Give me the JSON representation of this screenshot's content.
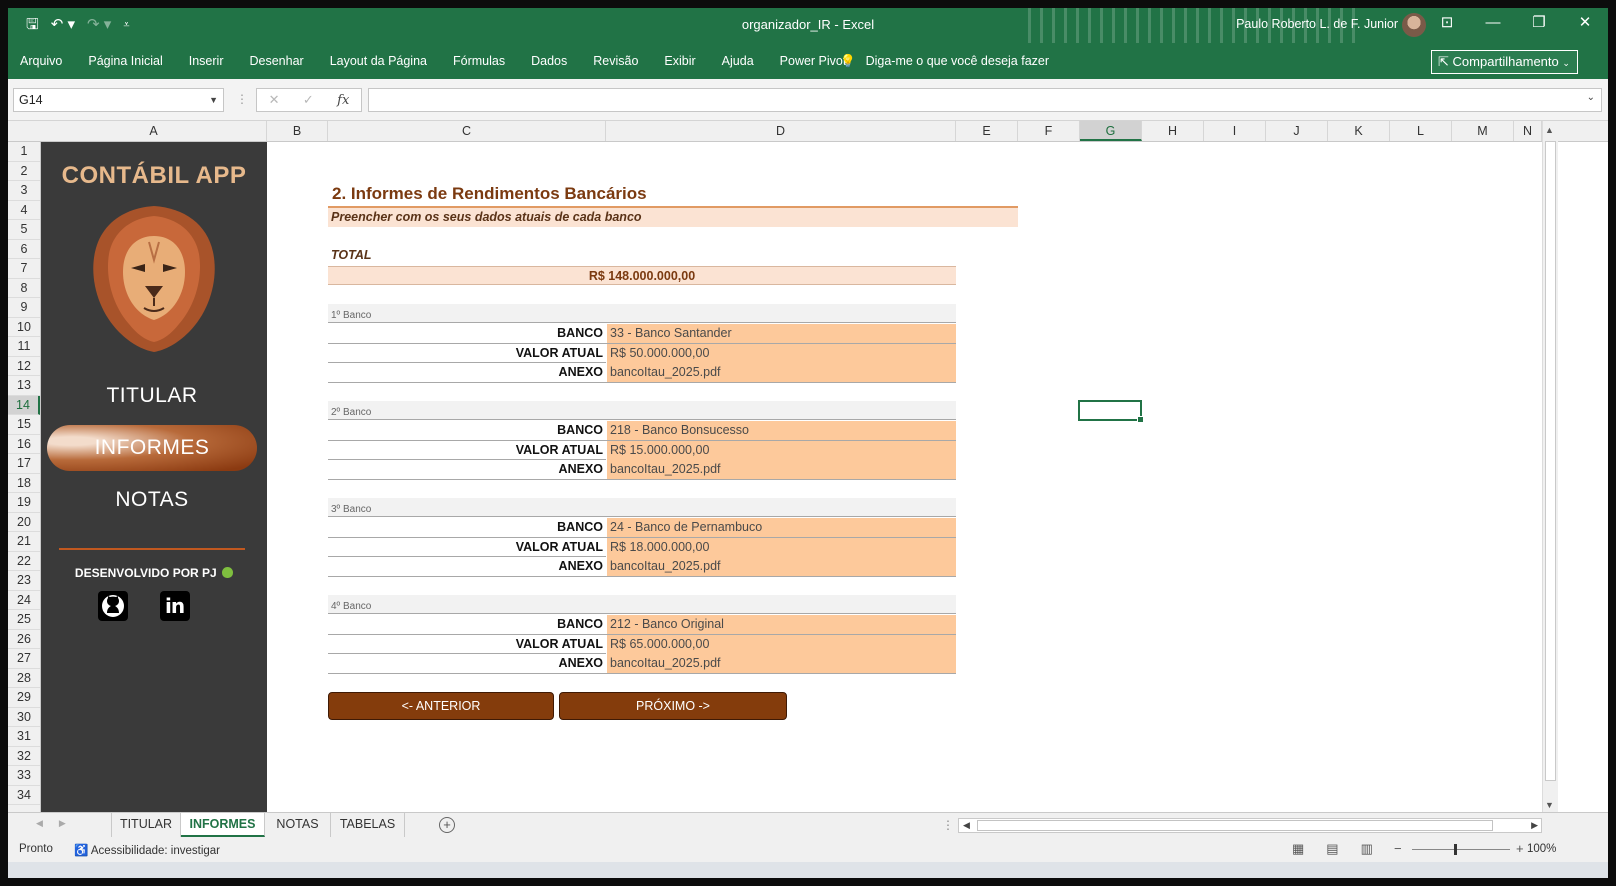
{
  "window": {
    "title": "organizador_IR  -  Excel",
    "user": "Paulo Roberto L. de F. Junior",
    "share_label": "Compartilhamento"
  },
  "ribbon": {
    "tabs": [
      "Arquivo",
      "Página Inicial",
      "Inserir",
      "Desenhar",
      "Layout da Página",
      "Fórmulas",
      "Dados",
      "Revisão",
      "Exibir",
      "Ajuda",
      "Power Pivot"
    ],
    "tell_me": "Diga-me o que você deseja fazer"
  },
  "formula_bar": {
    "name_box": "G14",
    "cancel_icon": "✕",
    "enter_icon": "✓",
    "fx_icon": "fx",
    "value": ""
  },
  "grid": {
    "columns": [
      "A",
      "B",
      "C",
      "D",
      "E",
      "F",
      "G",
      "H",
      "I",
      "J",
      "K",
      "L",
      "M",
      "N"
    ],
    "selected_column": "G",
    "rows": [
      "1",
      "2",
      "3",
      "4",
      "5",
      "6",
      "7",
      "8",
      "9",
      "10",
      "11",
      "12",
      "13",
      "14",
      "15",
      "16",
      "17",
      "18",
      "19",
      "20",
      "21",
      "22",
      "23",
      "24",
      "25",
      "26",
      "27",
      "28",
      "29",
      "30",
      "31",
      "32",
      "33",
      "34"
    ],
    "selected_row": "14"
  },
  "sidebar": {
    "brand": "CONTÁBIL APP",
    "nav": [
      {
        "label": "TITULAR",
        "active": false
      },
      {
        "label": "INFORMES",
        "active": true
      },
      {
        "label": "NOTAS",
        "active": false
      }
    ],
    "developed_by": "DESENVOLVIDO POR PJ",
    "social": [
      "github-icon",
      "linkedin-icon"
    ],
    "linkedin_text": "in"
  },
  "form": {
    "title": "2. Informes de Rendimentos Bancários",
    "subtitle": "Preencher com os seus dados atuais de cada banco",
    "total_label": "TOTAL",
    "total_value": "R$ 148.000.000,00",
    "banks": [
      {
        "header": "1º Banco",
        "banco_label": "BANCO",
        "banco": "33 - Banco Santander",
        "valor_label": "VALOR ATUAL",
        "valor": "R$ 50.000.000,00",
        "anexo_label": "ANEXO",
        "anexo": "bancoItau_2025.pdf"
      },
      {
        "header": "2º Banco",
        "banco_label": "BANCO",
        "banco": "218 - Banco Bonsucesso",
        "valor_label": "VALOR ATUAL",
        "valor": "R$ 15.000.000,00",
        "anexo_label": "ANEXO",
        "anexo": "bancoItau_2025.pdf"
      },
      {
        "header": "3º Banco",
        "banco_label": "BANCO",
        "banco": "24 - Banco de Pernambuco",
        "valor_label": "VALOR ATUAL",
        "valor": "R$ 18.000.000,00",
        "anexo_label": "ANEXO",
        "anexo": "bancoItau_2025.pdf"
      },
      {
        "header": "4º Banco",
        "banco_label": "BANCO",
        "banco": "212 - Banco Original",
        "valor_label": "VALOR ATUAL",
        "valor": "R$ 65.000.000,00",
        "anexo_label": "ANEXO",
        "anexo": "bancoItau_2025.pdf"
      }
    ],
    "prev_label": "<- ANTERIOR",
    "next_label": "PRÓXIMO ->"
  },
  "sheet_tabs": [
    {
      "label": "TITULAR",
      "active": false
    },
    {
      "label": "INFORMES",
      "active": true
    },
    {
      "label": "NOTAS",
      "active": false
    },
    {
      "label": "TABELAS",
      "active": false
    }
  ],
  "status": {
    "ready": "Pronto",
    "accessibility": "Acessibilidade: investigar",
    "zoom": "100%"
  },
  "colors": {
    "excel_green": "#217346",
    "sidebar_bg": "#3a3a3a",
    "brand_text": "#e7b98c",
    "accent_brown": "#843c0c",
    "input_fill": "#fdc99b",
    "pale_fill": "#fbe3d3"
  }
}
